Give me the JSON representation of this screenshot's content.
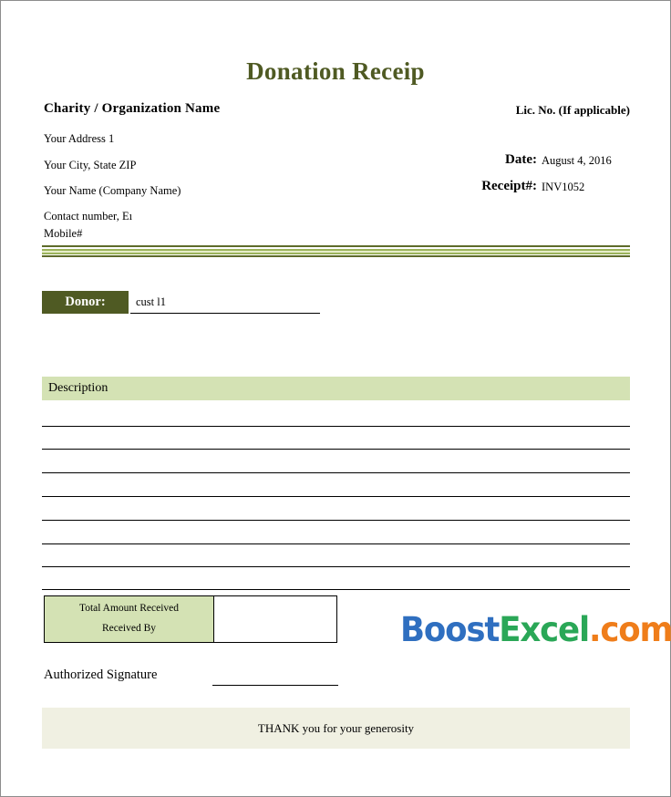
{
  "document": {
    "title": "Donation Receip"
  },
  "header": {
    "organization_name": "Charity / Organization Name",
    "license_label": "Lic. No. (If applicable)",
    "address_lines": [
      "Your Address 1",
      "Your City, State ZIP",
      "Your Name (Company Name)",
      "Contact number, Eı",
      "Mobile#"
    ],
    "date_label": "Date:",
    "date_value": "August 4, 2016",
    "receipt_label": "Receipt#:",
    "receipt_value": "INV1052"
  },
  "donor": {
    "label": "Donor:",
    "value": "cust l1"
  },
  "description": {
    "header": "Description",
    "rows": [
      "",
      "",
      "",
      "",
      "",
      "",
      "",
      ""
    ]
  },
  "totals": {
    "total_label": "Total Amount Received",
    "received_by_label": "Received By",
    "value": ""
  },
  "logo": {
    "part1": "Boost",
    "part2": "Excel",
    "part3": ".com"
  },
  "signature": {
    "label": "Authorized Signature",
    "value": ""
  },
  "footer": {
    "message": "THANK you for your generosity"
  },
  "colors": {
    "title_green": "#4f5a23",
    "dark_olive": "#4f5a23",
    "sage": "#d4e2b4",
    "cream": "#f0f0e2",
    "logo_blue": "#2f6fc0",
    "logo_green": "#2aa757",
    "logo_orange": "#ef7d1a"
  }
}
